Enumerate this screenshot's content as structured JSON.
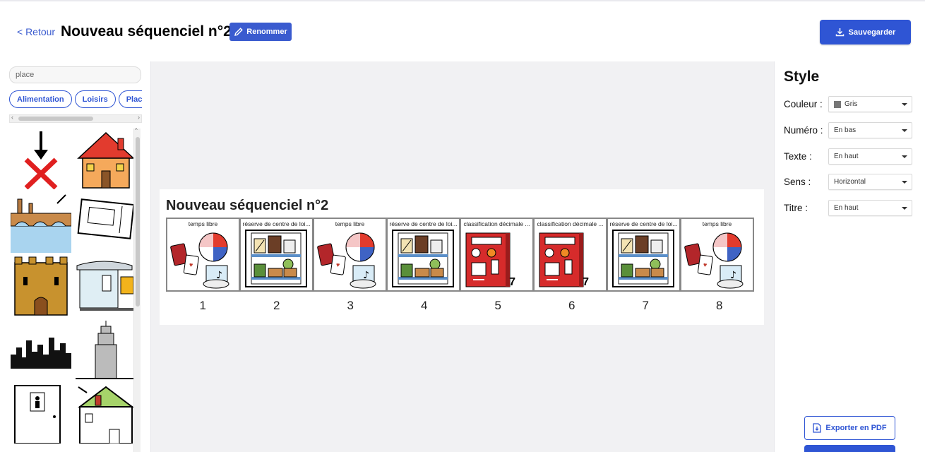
{
  "header": {
    "back_label": "< Retour",
    "title": "Nouveau séquenciel n°2",
    "rename_label": "Renommer",
    "save_label": "Sauvegarder"
  },
  "library": {
    "search_value": "place",
    "categories": [
      "Alimentation",
      "Loisirs",
      "Place"
    ],
    "pictograms": [
      "down-arrow-x",
      "house",
      "bridge",
      "ticket",
      "castle",
      "bus-shelter",
      "city-skyline",
      "skyscraper",
      "door",
      "house-attic"
    ]
  },
  "sequence": {
    "title": "Nouveau séquenciel n°2",
    "cells": [
      {
        "label": "temps libre",
        "number": "1",
        "pict": "leisure"
      },
      {
        "label": "réserve de centre de loi...",
        "number": "2",
        "pict": "shelf"
      },
      {
        "label": "temps libre",
        "number": "3",
        "pict": "leisure"
      },
      {
        "label": "réserve de centre de loi...",
        "number": "4",
        "pict": "shelf"
      },
      {
        "label": "classification décimale ...",
        "number": "5",
        "pict": "book",
        "badge": "7"
      },
      {
        "label": "classification décimale ...",
        "number": "6",
        "pict": "book",
        "badge": "7"
      },
      {
        "label": "réserve de centre de loi...",
        "number": "7",
        "pict": "shelf"
      },
      {
        "label": "temps libre",
        "number": "8",
        "pict": "leisure"
      }
    ]
  },
  "style": {
    "heading": "Style",
    "rows": [
      {
        "label": "Couleur :",
        "value": "Gris",
        "swatch": "#777777"
      },
      {
        "label": "Numéro :",
        "value": "En bas"
      },
      {
        "label": "Texte :",
        "value": "En haut"
      },
      {
        "label": "Sens :",
        "value": "Horizontal"
      },
      {
        "label": "Titre :",
        "value": "En haut"
      }
    ],
    "export_label": "Exporter en PDF"
  },
  "colors": {
    "accent": "#2f55d4",
    "canvas": "#f1f1f3"
  }
}
